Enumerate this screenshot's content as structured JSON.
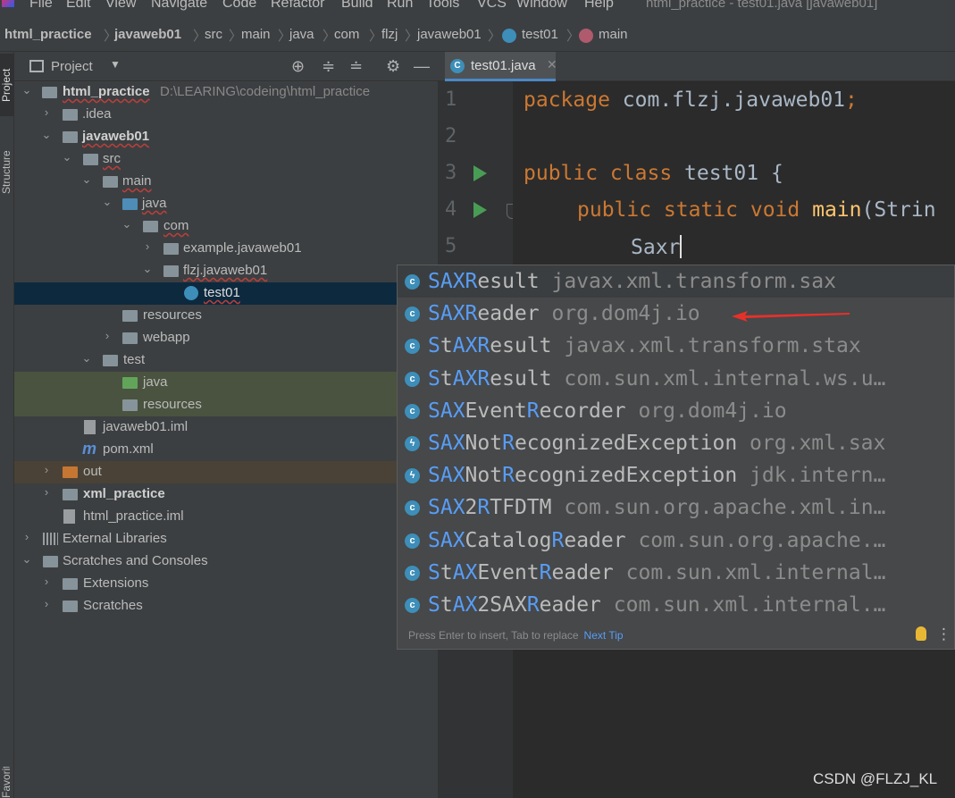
{
  "menubar": {
    "items": [
      "File",
      "Edit",
      "View",
      "Navigate",
      "Code",
      "Refactor",
      "Build",
      "Run",
      "Tools",
      "VCS",
      "Window",
      "Help"
    ],
    "window_title": "html_practice - test01.java [javaweb01]"
  },
  "breadcrumbs": [
    "html_practice",
    "javaweb01",
    "src",
    "main",
    "java",
    "com",
    "flzj",
    "javaweb01",
    "test01",
    "main"
  ],
  "left_strip": {
    "project_tab": "Project",
    "structure_tab": "Structure",
    "favorites_tab": "Favorites"
  },
  "project_panel": {
    "title": "Project",
    "tree": [
      {
        "label": "html_practice",
        "extra": "D:\\LEARING\\codeing\\html_practice"
      },
      {
        "label": ".idea"
      },
      {
        "label": "javaweb01"
      },
      {
        "label": "src"
      },
      {
        "label": "main"
      },
      {
        "label": "java"
      },
      {
        "label": "com"
      },
      {
        "label": "example.javaweb01"
      },
      {
        "label": "flzj.javaweb01"
      },
      {
        "label": "test01"
      },
      {
        "label": "resources"
      },
      {
        "label": "webapp"
      },
      {
        "label": "test"
      },
      {
        "label": "java"
      },
      {
        "label": "resources"
      },
      {
        "label": "javaweb01.iml"
      },
      {
        "label": "pom.xml"
      },
      {
        "label": "out"
      },
      {
        "label": "xml_practice"
      },
      {
        "label": "html_practice.iml"
      },
      {
        "label": "External Libraries"
      },
      {
        "label": "Scratches and Consoles"
      },
      {
        "label": "Extensions"
      },
      {
        "label": "Scratches"
      }
    ]
  },
  "editor": {
    "tab_label": "test01.java",
    "line_numbers": [
      "1",
      "2",
      "3",
      "4",
      "5"
    ],
    "code": {
      "l1_kw": "package",
      "l1_rest": " com.flzj.javaweb01",
      "l1_semi": ";",
      "l3_kw": "public class",
      "l3_rest": " test01 {",
      "l4_kw": "public static void",
      "l4_fn": "main",
      "l4_rest": "(Strin",
      "l5_text": "Saxr"
    }
  },
  "completion": {
    "items": [
      {
        "icon": "c",
        "parts": [
          [
            "SAXR",
            1
          ],
          [
            "esult",
            0
          ]
        ],
        "pkg": "javax.xml.transform.sax"
      },
      {
        "icon": "c",
        "parts": [
          [
            "SAXR",
            1
          ],
          [
            "eader",
            0
          ]
        ],
        "pkg": "org.dom4j.io"
      },
      {
        "icon": "c",
        "parts": [
          [
            "S",
            1
          ],
          [
            "t",
            0
          ],
          [
            "AXR",
            1
          ],
          [
            "esult",
            0
          ]
        ],
        "pkg": "javax.xml.transform.stax"
      },
      {
        "icon": "c",
        "parts": [
          [
            "S",
            1
          ],
          [
            "t",
            0
          ],
          [
            "AXR",
            1
          ],
          [
            "esult",
            0
          ]
        ],
        "pkg": "com.sun.xml.internal.ws.u…"
      },
      {
        "icon": "c",
        "parts": [
          [
            "SAX",
            1
          ],
          [
            "Event",
            0
          ],
          [
            "R",
            1
          ],
          [
            "ecorder",
            0
          ]
        ],
        "pkg": "org.dom4j.io"
      },
      {
        "icon": "e",
        "parts": [
          [
            "SAX",
            1
          ],
          [
            "Not",
            0
          ],
          [
            "R",
            1
          ],
          [
            "ecognizedException",
            0
          ]
        ],
        "pkg": "org.xml.sax"
      },
      {
        "icon": "e",
        "parts": [
          [
            "SAX",
            1
          ],
          [
            "Not",
            0
          ],
          [
            "R",
            1
          ],
          [
            "ecognizedException",
            0
          ]
        ],
        "pkg": "jdk.intern…"
      },
      {
        "icon": "c",
        "parts": [
          [
            "SAX",
            1
          ],
          [
            "2",
            0
          ],
          [
            "R",
            1
          ],
          [
            "TFDTM",
            0
          ]
        ],
        "pkg": "com.sun.org.apache.xml.in…"
      },
      {
        "icon": "c",
        "parts": [
          [
            "SAX",
            1
          ],
          [
            "Catalog",
            0
          ],
          [
            "R",
            1
          ],
          [
            "eader",
            0
          ]
        ],
        "pkg": "com.sun.org.apache.…"
      },
      {
        "icon": "c",
        "parts": [
          [
            "S",
            1
          ],
          [
            "t",
            0
          ],
          [
            "AX",
            1
          ],
          [
            "Event",
            0
          ],
          [
            "R",
            1
          ],
          [
            "eader",
            0
          ]
        ],
        "pkg": "com.sun.xml.internal…"
      },
      {
        "icon": "c",
        "parts": [
          [
            "S",
            1
          ],
          [
            "t",
            0
          ],
          [
            "AX",
            1
          ],
          [
            "2SAX",
            0
          ],
          [
            "R",
            1
          ],
          [
            "eader",
            0
          ]
        ],
        "pkg": "com.sun.xml.internal.…"
      }
    ],
    "footer": "Press Enter to insert, Tab to replace",
    "next_tip": "Next Tip"
  },
  "watermark": "CSDN @FLZJ_KL",
  "colors": {
    "keyword": "#cc7832",
    "method": "#ffc66d",
    "match_highlight": "#589df6",
    "selection": "#0d293e",
    "annotation_arrow": "#e8302a"
  }
}
